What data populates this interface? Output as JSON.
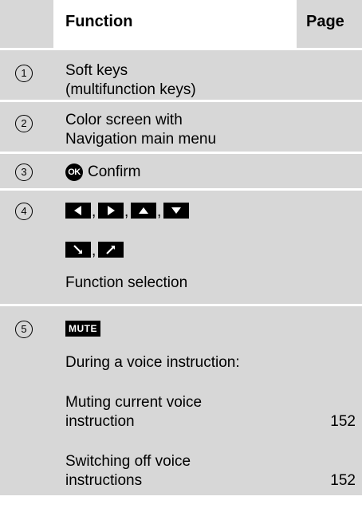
{
  "header": {
    "function": "Function",
    "page": "Page"
  },
  "rows": [
    {
      "num": "1",
      "lines": [
        "Soft keys",
        "(multifunction keys)"
      ],
      "page": ""
    },
    {
      "num": "2",
      "lines": [
        "Color screen with",
        "Navigation main menu"
      ],
      "page": ""
    },
    {
      "num": "3",
      "badge": "OK",
      "text": "Confirm",
      "page": ""
    },
    {
      "num": "4",
      "separator": ",",
      "text": "Function selection",
      "icons_line1": [
        "arrow-left-icon",
        "arrow-right-icon",
        "arrow-up-icon",
        "arrow-down-icon"
      ],
      "icons_line2": [
        "arrow-diagonal-down-icon",
        "arrow-diagonal-up-icon"
      ],
      "page": ""
    },
    {
      "num": "5",
      "badge": "MUTE",
      "text1": "During a voice instruction:",
      "text2": [
        "Muting current voice",
        "instruction"
      ],
      "page2": "152",
      "text3": [
        "Switching off voice",
        "instructions"
      ],
      "page3": "152"
    }
  ],
  "colors": {
    "grey": "#d7d7d7",
    "white": "#ffffff",
    "black": "#000000"
  }
}
